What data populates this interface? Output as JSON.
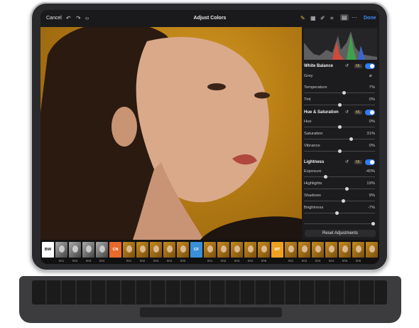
{
  "toolbar": {
    "cancel": "Cancel",
    "title": "Adjust Colors",
    "done": "Done"
  },
  "panel": {
    "white_balance": {
      "header": "White Balance",
      "ml": "ML",
      "grey_label": "Grey",
      "rows": [
        {
          "label": "Temperature",
          "value": "7%",
          "level": 0.56
        },
        {
          "label": "Tint",
          "value": "0%",
          "level": 0.5
        }
      ]
    },
    "hue_saturation": {
      "header": "Hue & Saturation",
      "ml": "ML",
      "rows": [
        {
          "label": "Hue",
          "value": "0%",
          "level": 0.5
        },
        {
          "label": "Saturation",
          "value": "31%",
          "level": 0.66
        },
        {
          "label": "Vibrance",
          "value": "0%",
          "level": 0.5
        }
      ]
    },
    "lightness": {
      "header": "Lightness",
      "ml": "ML",
      "rows": [
        {
          "label": "Exposure",
          "value": "-40%",
          "level": 0.3
        },
        {
          "label": "Highlights",
          "value": "19%",
          "level": 0.6
        },
        {
          "label": "Shadows",
          "value": "9%",
          "level": 0.55
        },
        {
          "label": "Brightness",
          "value": "-7%",
          "level": 0.46
        }
      ]
    },
    "reset_label": "Reset Adjustments"
  },
  "filmstrip": {
    "groups": [
      {
        "tag": "BW",
        "tag_color": "#ffffff",
        "text_color": "#111111",
        "items": [
          "001",
          "002",
          "003",
          "004"
        ]
      },
      {
        "tag": "CN",
        "tag_color": "#e8692b",
        "text_color": "#ffffff",
        "items": [
          "001",
          "002",
          "003",
          "004",
          "005"
        ]
      },
      {
        "tag": "CF",
        "tag_color": "#3a8fd8",
        "text_color": "#ffffff",
        "items": [
          "001",
          "002",
          "003",
          "004",
          "005"
        ]
      },
      {
        "tag": "MT",
        "tag_color": "#f0a020",
        "text_color": "#ffffff",
        "items": [
          "001",
          "002",
          "003",
          "004",
          "005",
          "006"
        ]
      }
    ]
  },
  "icons": [
    "undo-icon",
    "redo-icon",
    "compare-icon",
    "adjust-icon",
    "layers-icon",
    "brush-icon",
    "crop-icon",
    "grid-icon",
    "more-icon",
    "reset-icon",
    "eyedropper-icon",
    "chevron-down-icon"
  ],
  "colors": {
    "accent": "#2f7bf6",
    "ml": "#e0b84a",
    "backdrop": "#c08419"
  }
}
